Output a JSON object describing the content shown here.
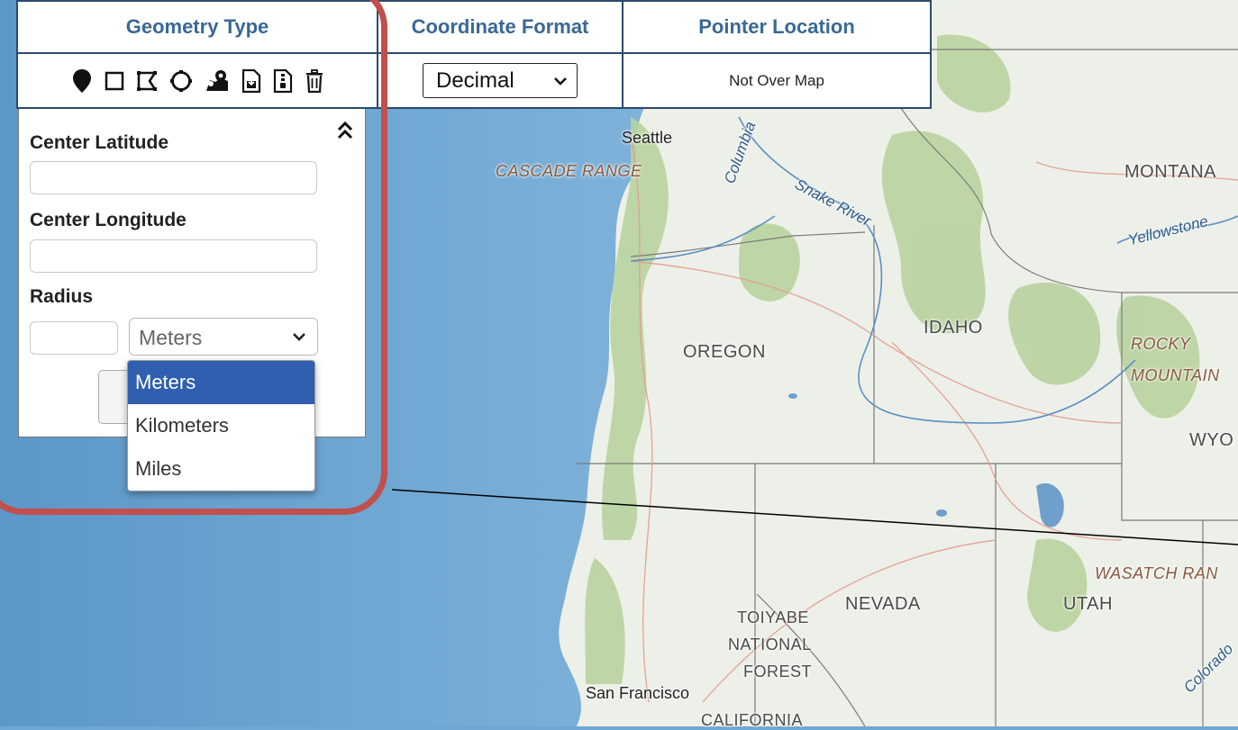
{
  "toolbar": {
    "geometry_header": "Geometry Type",
    "format_header": "Coordinate Format",
    "pointer_header": "Pointer Location",
    "geometry_icons": [
      "point-icon",
      "rectangle-icon",
      "polygon-icon",
      "circle-icon",
      "multipoint-icon",
      "import-file-icon",
      "export-file-icon",
      "trash-icon"
    ],
    "format_value": "Decimal",
    "pointer_value": "Not Over Map"
  },
  "panel": {
    "center_lat_label": "Center Latitude",
    "center_lat_value": "",
    "center_lon_label": "Center Longitude",
    "center_lon_value": "",
    "radius_label": "Radius",
    "radius_value": "",
    "unit_selected": "Meters",
    "unit_options": [
      "Meters",
      "Kilometers",
      "Miles"
    ]
  },
  "map_labels": {
    "seattle": "Seattle",
    "cascade": "CASCADE RANGE",
    "columbia": "Columbia",
    "snake": "Snake River",
    "montana": "MONTANA",
    "yellowstone": "Yellowstone",
    "idaho": "IDAHO",
    "oregon": "OREGON",
    "rocky1": "ROCKY",
    "rocky2": "MOUNTAIN",
    "wyo": "WYO",
    "wasatch": "WASATCH RAN",
    "nevada": "NEVADA",
    "utah": "UTAH",
    "toiyabe1": "TOIYABE",
    "toiyabe2": "NATIONAL",
    "toiyabe3": "FOREST",
    "sanfrancisco": "San Francisco",
    "california": "CALIFORNIA",
    "colorado": "Colorado"
  },
  "colors": {
    "ocean": "#6fa6d2",
    "land": "#eef1ea",
    "forest": "#b9d3a0",
    "header_text": "#3a6896",
    "highlight": "#c0504d",
    "selected_option": "#2f5fae"
  }
}
